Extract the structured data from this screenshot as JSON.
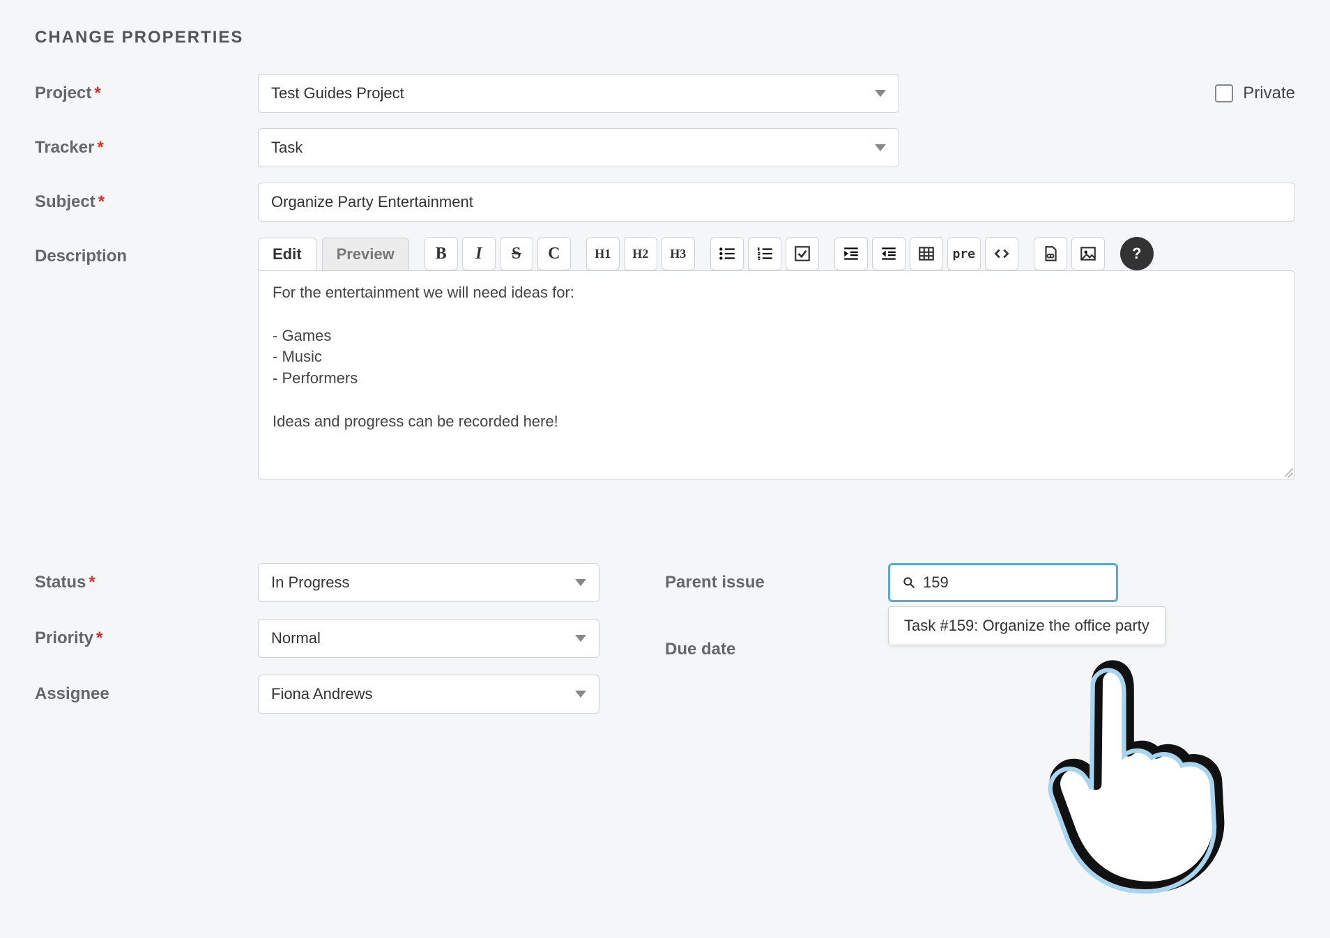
{
  "heading": "Change Properties",
  "fields": {
    "project": {
      "label": "Project",
      "value": "Test Guides Project"
    },
    "tracker": {
      "label": "Tracker",
      "value": "Task"
    },
    "subject": {
      "label": "Subject",
      "value": "Organize Party Entertainment"
    },
    "description": {
      "label": "Description"
    },
    "status": {
      "label": "Status",
      "value": "In Progress"
    },
    "priority": {
      "label": "Priority",
      "value": "Normal"
    },
    "assignee": {
      "label": "Assignee",
      "value": "Fiona Andrews"
    },
    "parent_issue": {
      "label": "Parent issue",
      "value": "159",
      "suggestion": "Task #159: Organize the office party"
    },
    "due_date": {
      "label": "Due date"
    }
  },
  "private": {
    "label": "Private",
    "checked": false
  },
  "editor": {
    "tabs": {
      "edit": "Edit",
      "preview": "Preview"
    },
    "content": "For the entertainment we will need ideas for:\n\n- Games\n- Music\n- Performers\n\nIdeas and progress can be recorded here!",
    "buttons": {
      "bold": "B",
      "italic": "I",
      "strike": "S",
      "code_inline": "C",
      "h1": "H1",
      "h2": "H2",
      "h3": "H3",
      "pre": "pre"
    }
  }
}
